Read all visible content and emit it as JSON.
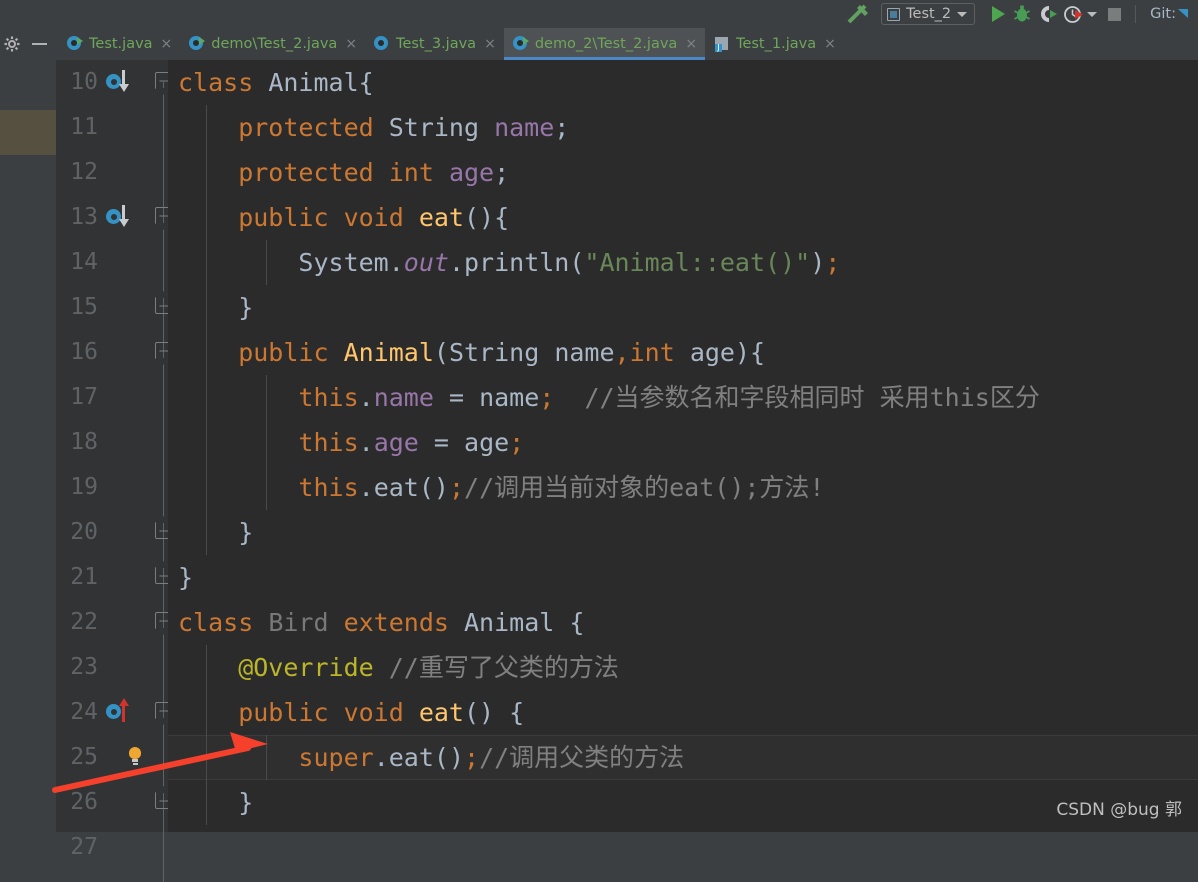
{
  "toolbar": {
    "build_icon": "hammer-icon",
    "run_config": {
      "label": "Test_2",
      "icon": "application-config-icon",
      "dropdown": "chevron-down-icon"
    },
    "run_button": "run-icon",
    "debug_button": "debug-icon",
    "run_coverage_button": "run-with-coverage-icon",
    "profile_button": "profiler-icon",
    "profile_dropdown": "chevron-down-icon",
    "stop_button": "stop-icon",
    "git_label": "Git:"
  },
  "tabstrip": {
    "settings_icon": "gear-icon",
    "hide_icon": "minimize-icon",
    "tabs": [
      {
        "label": "Test.java",
        "icon": "java-runnable-class-icon",
        "active": false,
        "close": "×"
      },
      {
        "label": "demo\\Test_2.java",
        "icon": "java-runnable-class-icon",
        "active": false,
        "close": "×"
      },
      {
        "label": "Test_3.java",
        "icon": "java-class-icon",
        "active": false,
        "close": "×"
      },
      {
        "label": "demo_2\\Test_2.java",
        "icon": "java-runnable-class-icon",
        "active": true,
        "close": "×"
      },
      {
        "label": "Test_1.java",
        "icon": "java-file-icon",
        "active": false,
        "close": "×"
      }
    ]
  },
  "editor": {
    "caret_line": 25,
    "lines": [
      {
        "num": "10",
        "indent": 0,
        "gutter": "overridden-method-icon",
        "tokens": [
          {
            "t": "class ",
            "c": "kw"
          },
          {
            "t": "Animal",
            "c": "typ"
          },
          {
            "t": "{",
            "c": "pn"
          }
        ]
      },
      {
        "num": "11",
        "indent": 1,
        "gutter": "",
        "tokens": [
          {
            "t": "    protected ",
            "c": "kw"
          },
          {
            "t": "String ",
            "c": "typ"
          },
          {
            "t": "name",
            "c": "fld"
          },
          {
            "t": ";",
            "c": "pn"
          }
        ]
      },
      {
        "num": "12",
        "indent": 1,
        "gutter": "",
        "tokens": [
          {
            "t": "    protected int ",
            "c": "kw"
          },
          {
            "t": "age",
            "c": "fld"
          },
          {
            "t": ";",
            "c": "pn"
          }
        ]
      },
      {
        "num": "13",
        "indent": 1,
        "gutter": "overridden-method-icon",
        "tokens": [
          {
            "t": "    public void ",
            "c": "kw"
          },
          {
            "t": "eat",
            "c": "mth"
          },
          {
            "t": "(){",
            "c": "pn"
          }
        ]
      },
      {
        "num": "14",
        "indent": 2,
        "gutter": "",
        "tokens": [
          {
            "t": "        System",
            "c": "typ"
          },
          {
            "t": ".",
            "c": "pn"
          },
          {
            "t": "out",
            "c": "sfld"
          },
          {
            "t": ".println(",
            "c": "pn"
          },
          {
            "t": "\"Animal::eat()\"",
            "c": "str"
          },
          {
            "t": ")",
            "c": "pn"
          },
          {
            "t": ";",
            "c": "kw"
          }
        ]
      },
      {
        "num": "15",
        "indent": 1,
        "gutter": "",
        "tokens": [
          {
            "t": "    }",
            "c": "pn"
          }
        ]
      },
      {
        "num": "16",
        "indent": 1,
        "gutter": "",
        "tokens": [
          {
            "t": "    public ",
            "c": "kw"
          },
          {
            "t": "Animal",
            "c": "mth"
          },
          {
            "t": "(",
            "c": "pn"
          },
          {
            "t": "String ",
            "c": "typ"
          },
          {
            "t": "name",
            "c": "pn"
          },
          {
            "t": ",",
            "c": "kw"
          },
          {
            "t": "int ",
            "c": "kw"
          },
          {
            "t": "age",
            "c": "pn"
          },
          {
            "t": "){",
            "c": "pn"
          }
        ]
      },
      {
        "num": "17",
        "indent": 2,
        "gutter": "",
        "tokens": [
          {
            "t": "        ",
            "c": "pn"
          },
          {
            "t": "this",
            "c": "kw"
          },
          {
            "t": ".",
            "c": "pn"
          },
          {
            "t": "name",
            "c": "fld"
          },
          {
            "t": " = name",
            "c": "pn"
          },
          {
            "t": ";",
            "c": "kw"
          },
          {
            "t": "  ",
            "c": "pn"
          },
          {
            "t": "//当参数名和字段相同时 采用this区分",
            "c": "cmt"
          }
        ]
      },
      {
        "num": "18",
        "indent": 2,
        "gutter": "",
        "tokens": [
          {
            "t": "        ",
            "c": "pn"
          },
          {
            "t": "this",
            "c": "kw"
          },
          {
            "t": ".",
            "c": "pn"
          },
          {
            "t": "age",
            "c": "fld"
          },
          {
            "t": " = age",
            "c": "pn"
          },
          {
            "t": ";",
            "c": "kw"
          }
        ]
      },
      {
        "num": "19",
        "indent": 2,
        "gutter": "",
        "tokens": [
          {
            "t": "        ",
            "c": "pn"
          },
          {
            "t": "this",
            "c": "kw"
          },
          {
            "t": ".eat()",
            "c": "pn"
          },
          {
            "t": ";",
            "c": "kw"
          },
          {
            "t": "//调用当前对象的eat();方法!",
            "c": "cmt"
          }
        ]
      },
      {
        "num": "20",
        "indent": 1,
        "gutter": "",
        "tokens": [
          {
            "t": "    }",
            "c": "pn"
          }
        ]
      },
      {
        "num": "21",
        "indent": 0,
        "gutter": "",
        "tokens": [
          {
            "t": "}",
            "c": "pn"
          }
        ]
      },
      {
        "num": "22",
        "indent": 0,
        "gutter": "",
        "tokens": [
          {
            "t": "class ",
            "c": "kw"
          },
          {
            "t": "Bird ",
            "c": "grey"
          },
          {
            "t": "extends ",
            "c": "kw"
          },
          {
            "t": "Animal",
            "c": "typ"
          },
          {
            "t": " {",
            "c": "pn"
          }
        ]
      },
      {
        "num": "23",
        "indent": 1,
        "gutter": "",
        "tokens": [
          {
            "t": "    @Override",
            "c": "ann"
          },
          {
            "t": " //重写了父类的方法",
            "c": "cmt"
          }
        ]
      },
      {
        "num": "24",
        "indent": 1,
        "gutter": "overriding-method-icon",
        "tokens": [
          {
            "t": "    public void ",
            "c": "kw"
          },
          {
            "t": "eat",
            "c": "mth"
          },
          {
            "t": "() {",
            "c": "pn"
          }
        ]
      },
      {
        "num": "25",
        "indent": 2,
        "gutter": "intention-bulb-icon",
        "tokens": [
          {
            "t": "        ",
            "c": "pn"
          },
          {
            "t": "super",
            "c": "kw"
          },
          {
            "t": ".eat()",
            "c": "pn"
          },
          {
            "t": ";",
            "c": "kw"
          },
          {
            "t": "//调用父类的方法",
            "c": "cmt"
          }
        ]
      },
      {
        "num": "26",
        "indent": 1,
        "gutter": "",
        "tokens": [
          {
            "t": "    }",
            "c": "pn"
          }
        ]
      },
      {
        "num": "27",
        "indent": 0,
        "gutter": "",
        "tokens": []
      }
    ],
    "fold_markers": [
      {
        "line": 0,
        "kind": "open"
      },
      {
        "line": 3,
        "kind": "open"
      },
      {
        "line": 5,
        "kind": "close"
      },
      {
        "line": 6,
        "kind": "open"
      },
      {
        "line": 10,
        "kind": "close"
      },
      {
        "line": 11,
        "kind": "close"
      },
      {
        "line": 12,
        "kind": "open"
      },
      {
        "line": 14,
        "kind": "open"
      },
      {
        "line": 16,
        "kind": "close"
      }
    ],
    "annotation_arrow": "red-pointer-arrow"
  },
  "watermark": {
    "text": "CSDN @bug 郭"
  },
  "colors": {
    "editor_bg": "#2B2B2B",
    "gutter_bg": "#313335",
    "chrome_bg": "#3C3F41",
    "active_tab_bg": "#4E5254",
    "active_tab_underline": "#4A88C7",
    "tab_text": "#6FA65B",
    "keyword": "#CC7832",
    "identifier": "#A9B7C6",
    "field": "#9876AA",
    "method": "#FFC66D",
    "string": "#6A8759",
    "comment": "#808080",
    "annotation": "#BBB529",
    "unused": "#787878",
    "line_number": "#606366",
    "marker_blue": "#3592C4",
    "marker_red": "#D0342C",
    "bulb_yellow": "#F0A732",
    "arrow_red": "#F5402C",
    "sidebar_highlight": "#55503F"
  }
}
